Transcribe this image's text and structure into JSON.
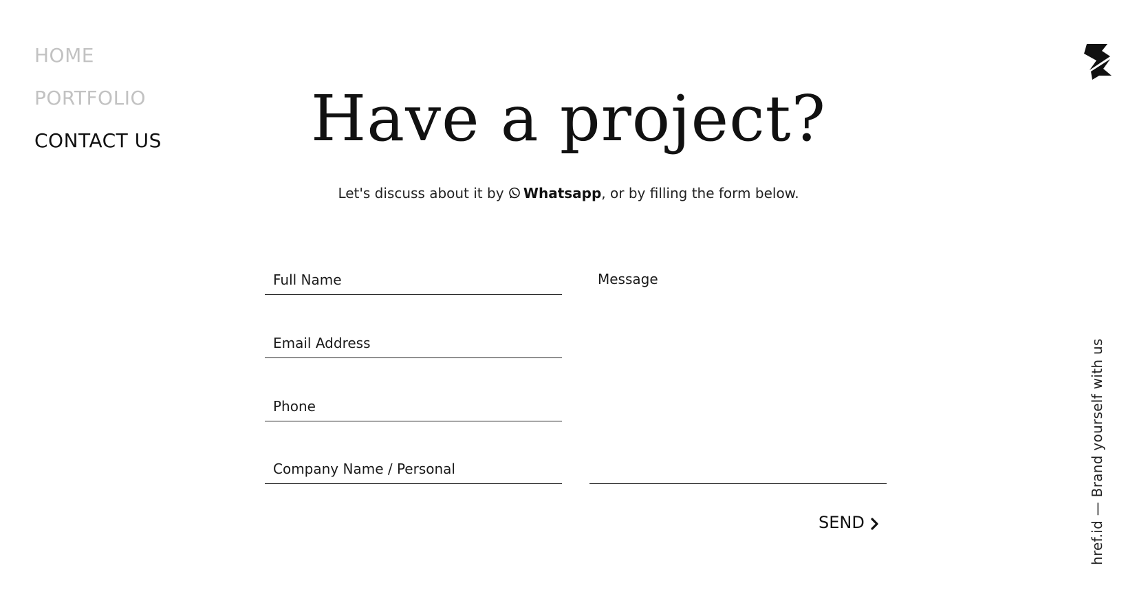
{
  "nav": {
    "items": [
      {
        "label": "HOME"
      },
      {
        "label": "PORTFOLIO"
      },
      {
        "label": "CONTACT US"
      }
    ]
  },
  "header": {
    "title": "Have a project?",
    "subtitle_prefix": "Let's discuss about it by ",
    "subtitle_link": "Whatsapp",
    "subtitle_suffix": ", or by filling the form below."
  },
  "form": {
    "full_name_placeholder": "Full Name",
    "email_placeholder": "Email Address",
    "phone_placeholder": "Phone",
    "company_placeholder": "Company Name / Personal",
    "message_placeholder": "Message",
    "send_label": "SEND"
  },
  "tagline": "href.id — Brand yourself with us",
  "icons": {
    "logo": "brand-logo-icon",
    "whatsapp": "whatsapp-icon",
    "send": "chevron-right-icon"
  },
  "colors": {
    "text": "#111111",
    "nav_muted": "#c2c2c2",
    "background": "#ffffff"
  }
}
